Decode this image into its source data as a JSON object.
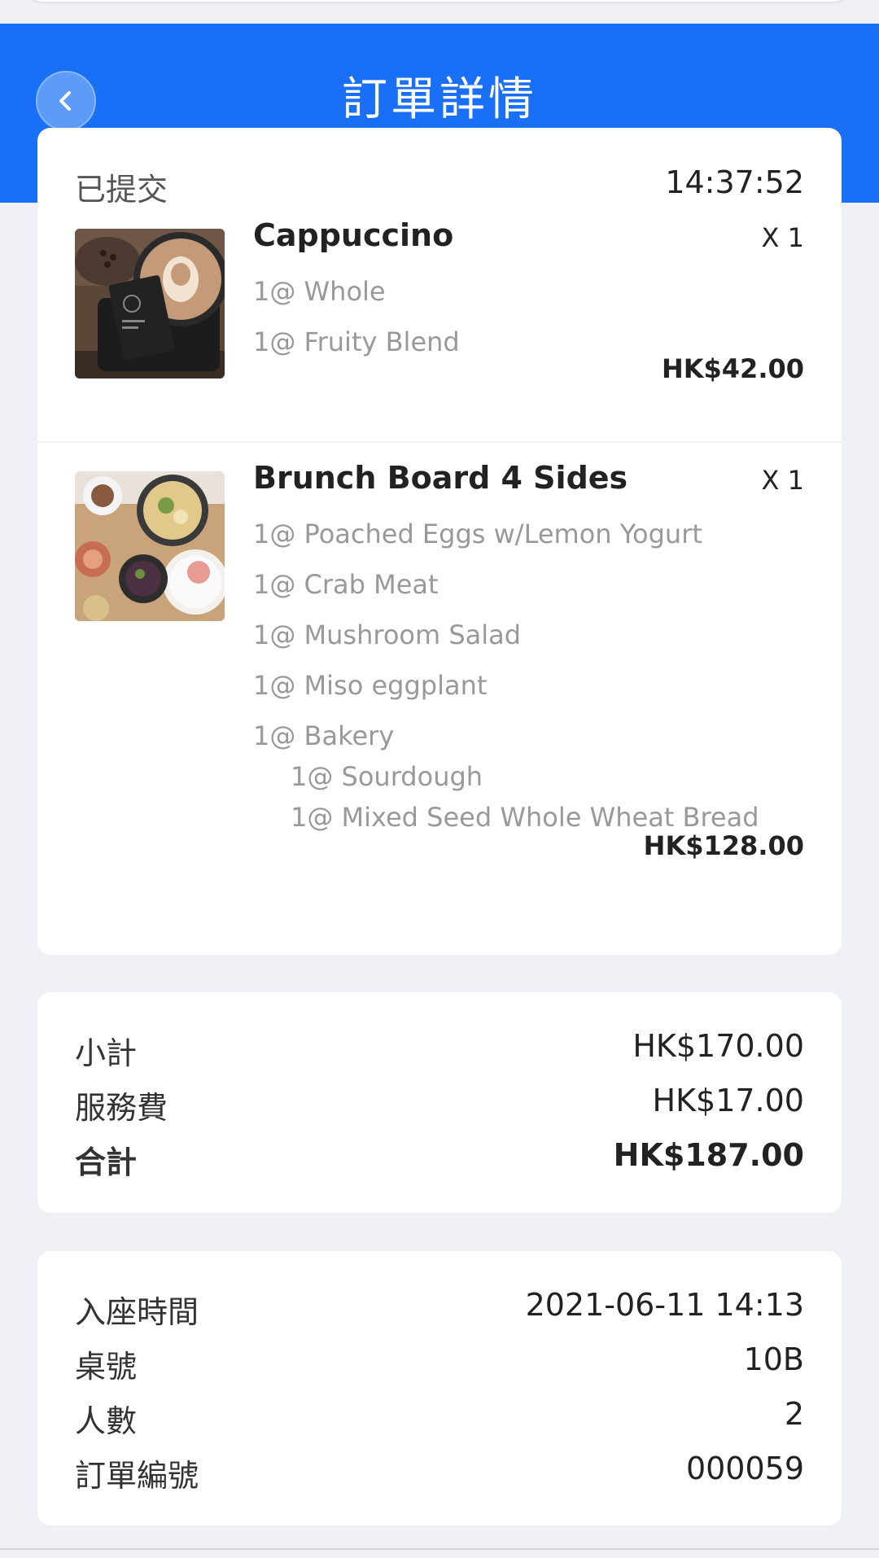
{
  "header": {
    "title": "訂單詳情",
    "back_icon": "chevron-left-icon",
    "color": "#1a6ff7"
  },
  "order": {
    "status": "已提交",
    "time": "14:37:52",
    "items": [
      {
        "name": "Cappuccino",
        "qty": "X 1",
        "options": [
          "1@ Whole",
          "1@ Fruity Blend"
        ],
        "sub_options": [],
        "price": "HK$42.00"
      },
      {
        "name": "Brunch Board 4 Sides",
        "qty": "X 1",
        "options": [
          "1@ Poached Eggs w/Lemon Yogurt",
          "1@ Crab Meat",
          "1@ Mushroom Salad",
          "1@ Miso eggplant",
          "1@ Bakery"
        ],
        "sub_options": [
          "1@ Sourdough",
          "1@ Mixed Seed Whole Wheat Bread"
        ],
        "price": "HK$128.00"
      }
    ]
  },
  "totals": {
    "subtotal_label": "小計",
    "subtotal_value": "HK$170.00",
    "service_label": "服務費",
    "service_value": "HK$17.00",
    "total_label": "合計",
    "total_value": "HK$187.00"
  },
  "info": {
    "seat_time_label": "入座時間",
    "seat_time_value": "2021-06-11 14:13",
    "table_label": "桌號",
    "table_value": "10B",
    "guests_label": "人數",
    "guests_value": "2",
    "order_no_label": "訂單編號",
    "order_no_value": "000059"
  }
}
